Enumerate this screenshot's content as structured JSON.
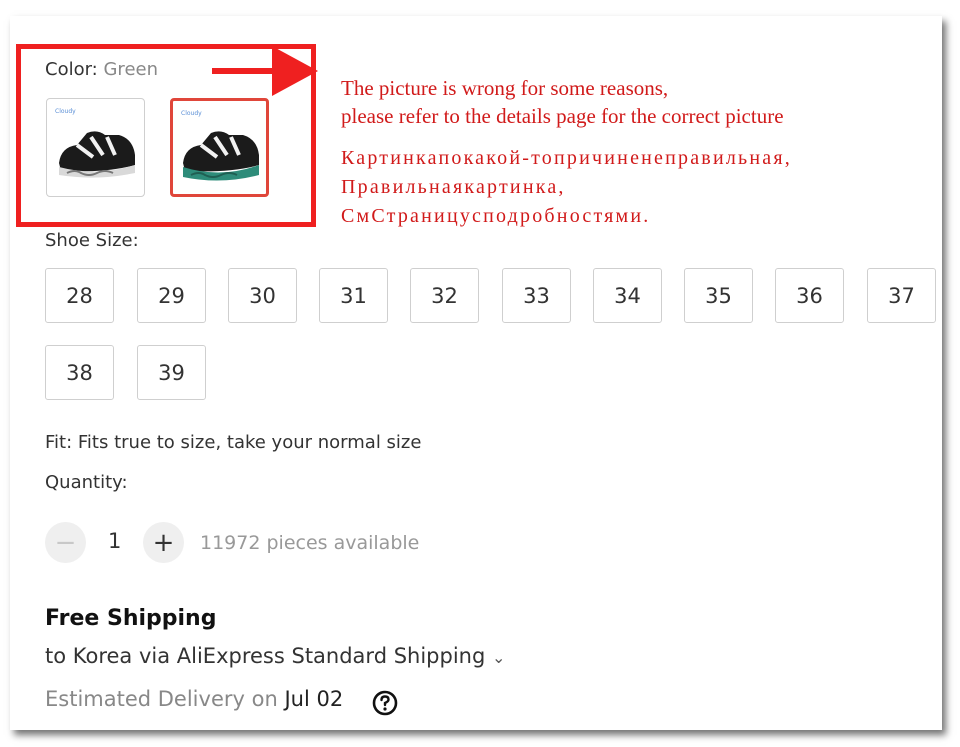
{
  "color": {
    "label": "Color:",
    "value": "Green",
    "options": [
      {
        "name": "black-sandal",
        "brand": "Cloudy",
        "selected": false
      },
      {
        "name": "green-sandal",
        "brand": "Cloudy",
        "selected": true
      }
    ]
  },
  "annotation": {
    "color": "#ef2020",
    "en_line1": "The picture is wrong for some reasons,",
    "en_line2": "please refer to the details page for the correct picture",
    "ru_line1": "Картинкапокакой-топричиненеправильная,",
    "ru_line2": "Правильнаякартинка,",
    "ru_line3": "СмСтраницуcподробностями."
  },
  "shoe_size": {
    "label": "Shoe Size:",
    "sizes": [
      "28",
      "29",
      "30",
      "31",
      "32",
      "33",
      "34",
      "35",
      "36",
      "37",
      "38",
      "39"
    ]
  },
  "fit_text": "Fit: Fits true to size, take your normal size",
  "quantity": {
    "label": "Quantity:",
    "minus": "−",
    "value": "1",
    "plus": "+",
    "available": "11972 pieces available"
  },
  "shipping": {
    "title": "Free Shipping",
    "line": "to Korea via AliExpress Standard Shipping",
    "chevron": "⌄",
    "delivery_label": "Estimated Delivery on",
    "delivery_date": "Jul 02",
    "help_icon": "question-circle-icon"
  }
}
